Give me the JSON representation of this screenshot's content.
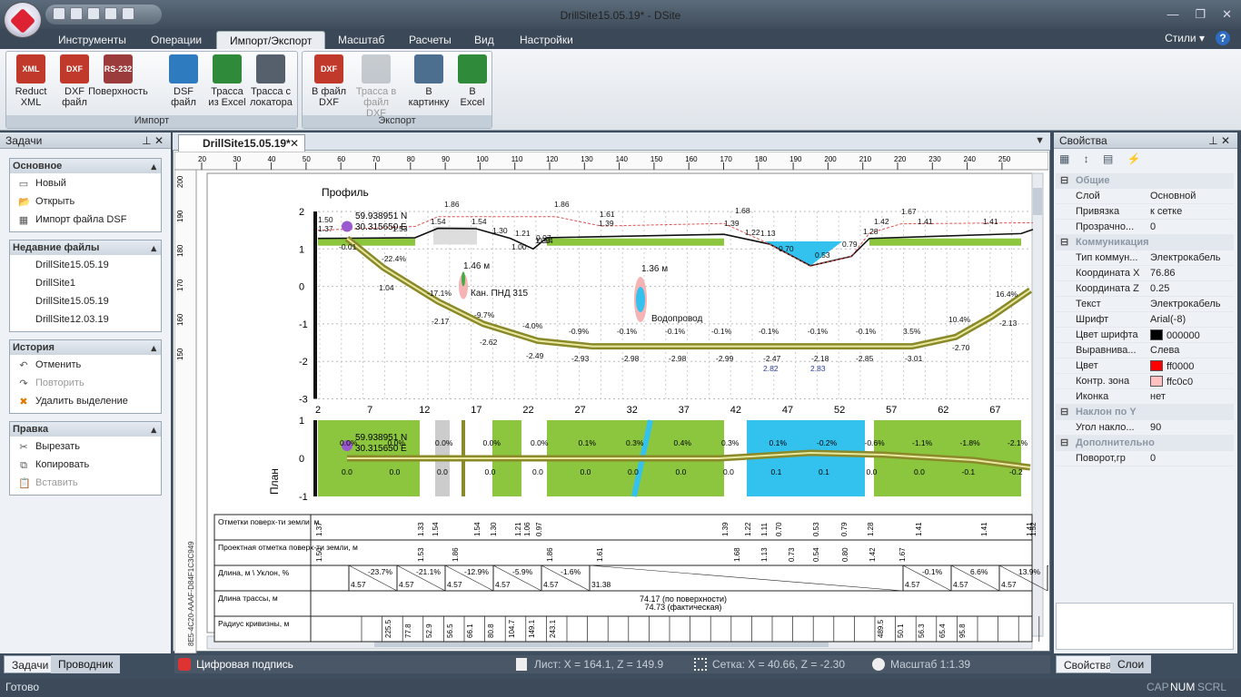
{
  "app": {
    "title": "DrillSite15.05.19* - DSite",
    "styles_label": "Стили",
    "help": "?"
  },
  "ribbon": {
    "tabs": [
      "Инструменты",
      "Операции",
      "Импорт/Экспорт",
      "Масштаб",
      "Расчеты",
      "Вид",
      "Настройки"
    ],
    "active_tab": "Импорт/Экспорт",
    "groups": [
      {
        "label": "Импорт",
        "buttons": [
          {
            "l1": "Reduct",
            "l2": "XML",
            "icon": "XML"
          },
          {
            "l1": "DXF",
            "l2": "файл",
            "icon": "DXF"
          },
          {
            "l1": "Поверхность",
            "l2": "",
            "icon": "RS-232"
          },
          {
            "l1": "DSF",
            "l2": "файл",
            "icon": "globe"
          },
          {
            "l1": "Трасса",
            "l2": "из Excel",
            "icon": "excel-route"
          },
          {
            "l1": "Трасса с",
            "l2": "локатора",
            "icon": "locator"
          }
        ]
      },
      {
        "label": "Экспорт",
        "buttons": [
          {
            "l1": "В файл",
            "l2": "DXF",
            "icon": "DXF",
            "disabled": false
          },
          {
            "l1": "Трасса в",
            "l2": "файл DXF",
            "icon": "route",
            "disabled": true
          },
          {
            "l1": "В",
            "l2": "картинку",
            "icon": "image",
            "disabled": false
          },
          {
            "l1": "В",
            "l2": "Excel",
            "icon": "excel",
            "disabled": false
          }
        ]
      }
    ]
  },
  "tasks": {
    "title": "Задачи",
    "sections": [
      {
        "title": "Основное",
        "items": [
          {
            "label": "Новый",
            "icon": "new-icon"
          },
          {
            "label": "Открыть",
            "icon": "open-icon"
          },
          {
            "label": "Импорт файла DSF",
            "icon": "import-icon"
          }
        ]
      },
      {
        "title": "Недавние файлы",
        "items": [
          {
            "label": "DrillSite15.05.19"
          },
          {
            "label": "DrillSite1"
          },
          {
            "label": "DrillSite15.05.19"
          },
          {
            "label": "DrillSite12.03.19"
          }
        ]
      },
      {
        "title": "История",
        "items": [
          {
            "label": "Отменить",
            "icon": "undo-icon",
            "disabled": false
          },
          {
            "label": "Повторить",
            "icon": "redo-icon",
            "disabled": true
          },
          {
            "label": "Удалить выделение",
            "icon": "delete-icon",
            "disabled": false
          }
        ]
      },
      {
        "title": "Правка",
        "items": [
          {
            "label": "Вырезать",
            "icon": "cut-icon",
            "disabled": false
          },
          {
            "label": "Копировать",
            "icon": "copy-icon",
            "disabled": false
          },
          {
            "label": "Вставить",
            "icon": "paste-icon",
            "disabled": true
          }
        ]
      }
    ]
  },
  "left_tabs": [
    "Задачи",
    "Проводник"
  ],
  "document": {
    "tab": "DrillSite15.05.19*",
    "ruler_top": [
      "20",
      "30",
      "40",
      "50",
      "60",
      "70",
      "80",
      "90",
      "100",
      "110",
      "120",
      "130",
      "140",
      "150",
      "160",
      "170",
      "180",
      "190",
      "200",
      "210",
      "220",
      "230",
      "240",
      "250"
    ],
    "ruler_left": [
      "200",
      "190",
      "180",
      "170",
      "160",
      "150"
    ],
    "profile_title": "Профиль",
    "plan_title": "План",
    "guid": "8E5-4C20-AAAF-D84F1C3C949",
    "profile_y": [
      "2",
      "1",
      "0",
      "-1",
      "-2",
      "-3"
    ],
    "plan_y": [
      "1",
      "0",
      "-1"
    ],
    "stations": [
      "2",
      "7",
      "12",
      "17",
      "22",
      "27",
      "32",
      "37",
      "42",
      "47",
      "52",
      "57",
      "62",
      "67"
    ],
    "coord_n": "59.938951 N",
    "coord_e": "30.315650 E",
    "profile_labels": [
      {
        "t": "1.86"
      },
      {
        "t": "1.86"
      },
      {
        "t": "1.61"
      },
      {
        "t": "1.68"
      },
      {
        "t": "1.67"
      },
      {
        "t": "1.50"
      },
      {
        "t": "1.37"
      },
      {
        "t": "1.53"
      },
      {
        "t": "1.54"
      },
      {
        "t": "1.54"
      },
      {
        "t": "1.30"
      },
      {
        "t": "1.21"
      },
      {
        "t": "1.30"
      },
      {
        "t": "0.97"
      },
      {
        "t": "1.39"
      },
      {
        "t": "1.39"
      },
      {
        "t": "1.22"
      },
      {
        "t": "1.13"
      },
      {
        "t": "0.70"
      },
      {
        "t": "0.53"
      },
      {
        "t": "0.79"
      },
      {
        "t": "1.28"
      },
      {
        "t": "1.42"
      },
      {
        "t": "1.41"
      },
      {
        "t": "1.41"
      },
      {
        "t": "1.00"
      },
      {
        "t": "0.54"
      },
      {
        "t": "-0.01"
      },
      {
        "t": "-22.4%"
      },
      {
        "t": "1.04"
      },
      {
        "t": "-17.1%"
      },
      {
        "t": "-2.17"
      },
      {
        "t": "-9.7%"
      },
      {
        "t": "-2.62"
      },
      {
        "t": "-4.0%"
      },
      {
        "t": "-2.49"
      },
      {
        "t": "-0.9%"
      },
      {
        "t": "-2.93"
      },
      {
        "t": "-0.1%"
      },
      {
        "t": "-2.98"
      },
      {
        "t": "-0.1%"
      },
      {
        "t": "-2.98"
      },
      {
        "t": "-0.1%"
      },
      {
        "t": "-2.99"
      },
      {
        "t": "-0.1%"
      },
      {
        "t": "-2.47"
      },
      {
        "t": "2.82"
      },
      {
        "t": "-0.1%"
      },
      {
        "t": "-2.18"
      },
      {
        "t": "2.83"
      },
      {
        "t": "-0.1%"
      },
      {
        "t": "-2.85"
      },
      {
        "t": "3.5%"
      },
      {
        "t": "-3.01"
      },
      {
        "t": "10.4%"
      },
      {
        "t": "-2.70"
      },
      {
        "t": "16.4%"
      },
      {
        "t": "-2.13"
      },
      {
        "t": "1.46 м"
      },
      {
        "t": "Кан. ПНД 315"
      },
      {
        "t": "1.36 м"
      },
      {
        "t": "Водопровод"
      }
    ],
    "plan_labels": [
      {
        "p": "0.0%",
        "v": "0.0"
      },
      {
        "p": "0.0%",
        "v": "0.0"
      },
      {
        "p": "0.0%",
        "v": "0.0"
      },
      {
        "p": "0.0%",
        "v": "0.0"
      },
      {
        "p": "0.0%",
        "v": "0.0"
      },
      {
        "p": "0.1%",
        "v": "0.0"
      },
      {
        "p": "0.3%",
        "v": "0.0"
      },
      {
        "p": "0.4%",
        "v": "0.0"
      },
      {
        "p": "0.3%",
        "v": "0.0"
      },
      {
        "p": "0.1%",
        "v": "0.1"
      },
      {
        "p": "-0.2%",
        "v": "0.1"
      },
      {
        "p": "-0.6%",
        "v": "0.0"
      },
      {
        "p": "-1.1%",
        "v": "0.0"
      },
      {
        "p": "-1.8%",
        "v": "-0.1"
      },
      {
        "p": "-2.1%",
        "v": "-0.2"
      }
    ],
    "table": {
      "rows": [
        "Отметки поверх-ти земли, м",
        "Проектная отметка поверх-ти земли, м",
        "Длина, м \\ Уклон, %",
        "Длина трассы, м",
        "Радиус кривизны, м"
      ],
      "surface": [
        "1.37",
        "1.33",
        "1.54",
        "1.54",
        "1.30",
        "1.21",
        "1.06",
        "0.97",
        "1.39",
        "1.22",
        "1.11",
        "0.70",
        "0.53",
        "0.79",
        "1.28",
        "1.41",
        "1.41",
        "1.41",
        "1.52"
      ],
      "project": [
        "1.50",
        "1.53",
        "1.86",
        "1.86",
        "1.61",
        "1.68",
        "1.13",
        "0.73",
        "0.54",
        "0.80",
        "1.42",
        "1.67"
      ],
      "slopes": [
        {
          "l": "4.57",
          "s": "-23.7%"
        },
        {
          "l": "4.57",
          "s": "-21.1%"
        },
        {
          "l": "4.57",
          "s": "-12.9%"
        },
        {
          "l": "4.57",
          "s": "-5.9%"
        },
        {
          "l": "4.57",
          "s": "-1.6%"
        },
        {
          "l": "31.38",
          "s": ""
        },
        {
          "l": "4.57",
          "s": "-0.1%"
        },
        {
          "l": "4.57",
          "s": "6.6%"
        },
        {
          "l": "4.57",
          "s": "13.9%"
        },
        {
          "l": "4.57",
          "s": ""
        }
      ],
      "length1": "74.17 (по поверхности)",
      "length2": "74.73 (фактическая)",
      "radius": [
        "225.5",
        "77.8",
        "52.9",
        "56.5",
        "66.1",
        "80.8",
        "104.7",
        "149.1",
        "243.1",
        "489.5",
        "50.1",
        "56.3",
        "65.4",
        "95.8"
      ]
    }
  },
  "doc_status": {
    "sign": "Цифровая подпись",
    "sheet": "Лист: X = 164.1, Z = 149.9",
    "grid": "Сетка: X = 40.66, Z = -2.30",
    "scale": "Масштаб 1:1.39"
  },
  "props": {
    "title": "Свойства",
    "rows": [
      {
        "cat": "Общие"
      },
      {
        "k": "Слой",
        "v": "Основной"
      },
      {
        "k": "Привязка",
        "v": "к сетке"
      },
      {
        "k": "Прозрачно...",
        "v": "0"
      },
      {
        "cat": "Коммуникация"
      },
      {
        "k": "Тип коммун...",
        "v": "Электрокабель"
      },
      {
        "k": "Координата X",
        "v": "76.86"
      },
      {
        "k": "Координата Z",
        "v": "0.25"
      },
      {
        "k": "Текст",
        "v": "Электрокабель"
      },
      {
        "k": "Шрифт",
        "v": "Arial(-8)"
      },
      {
        "k": "Цвет шрифта",
        "v": "000000",
        "c": "#000000"
      },
      {
        "k": "Выравнива...",
        "v": "Слева"
      },
      {
        "k": "Цвет",
        "v": "ff0000",
        "c": "#ff0000"
      },
      {
        "k": "Контр. зона",
        "v": "ffc0c0",
        "c": "#ffc0c0"
      },
      {
        "k": "Иконка",
        "v": "нет"
      },
      {
        "cat": "Наклон по Y"
      },
      {
        "k": "Угол накло...",
        "v": "90"
      },
      {
        "cat": "Дополнительно"
      },
      {
        "k": "Поворот,гр",
        "v": "0"
      }
    ],
    "tabs": [
      "Свойства",
      "Слои"
    ]
  },
  "status": {
    "ready": "Готово",
    "cap": "CAP",
    "num": "NUM",
    "scrl": "SCRL"
  },
  "colors": {
    "grass": "#8cc63f",
    "water": "#33c2ee",
    "pipe": "#8a8a2a",
    "accent": "#2b5c98"
  }
}
